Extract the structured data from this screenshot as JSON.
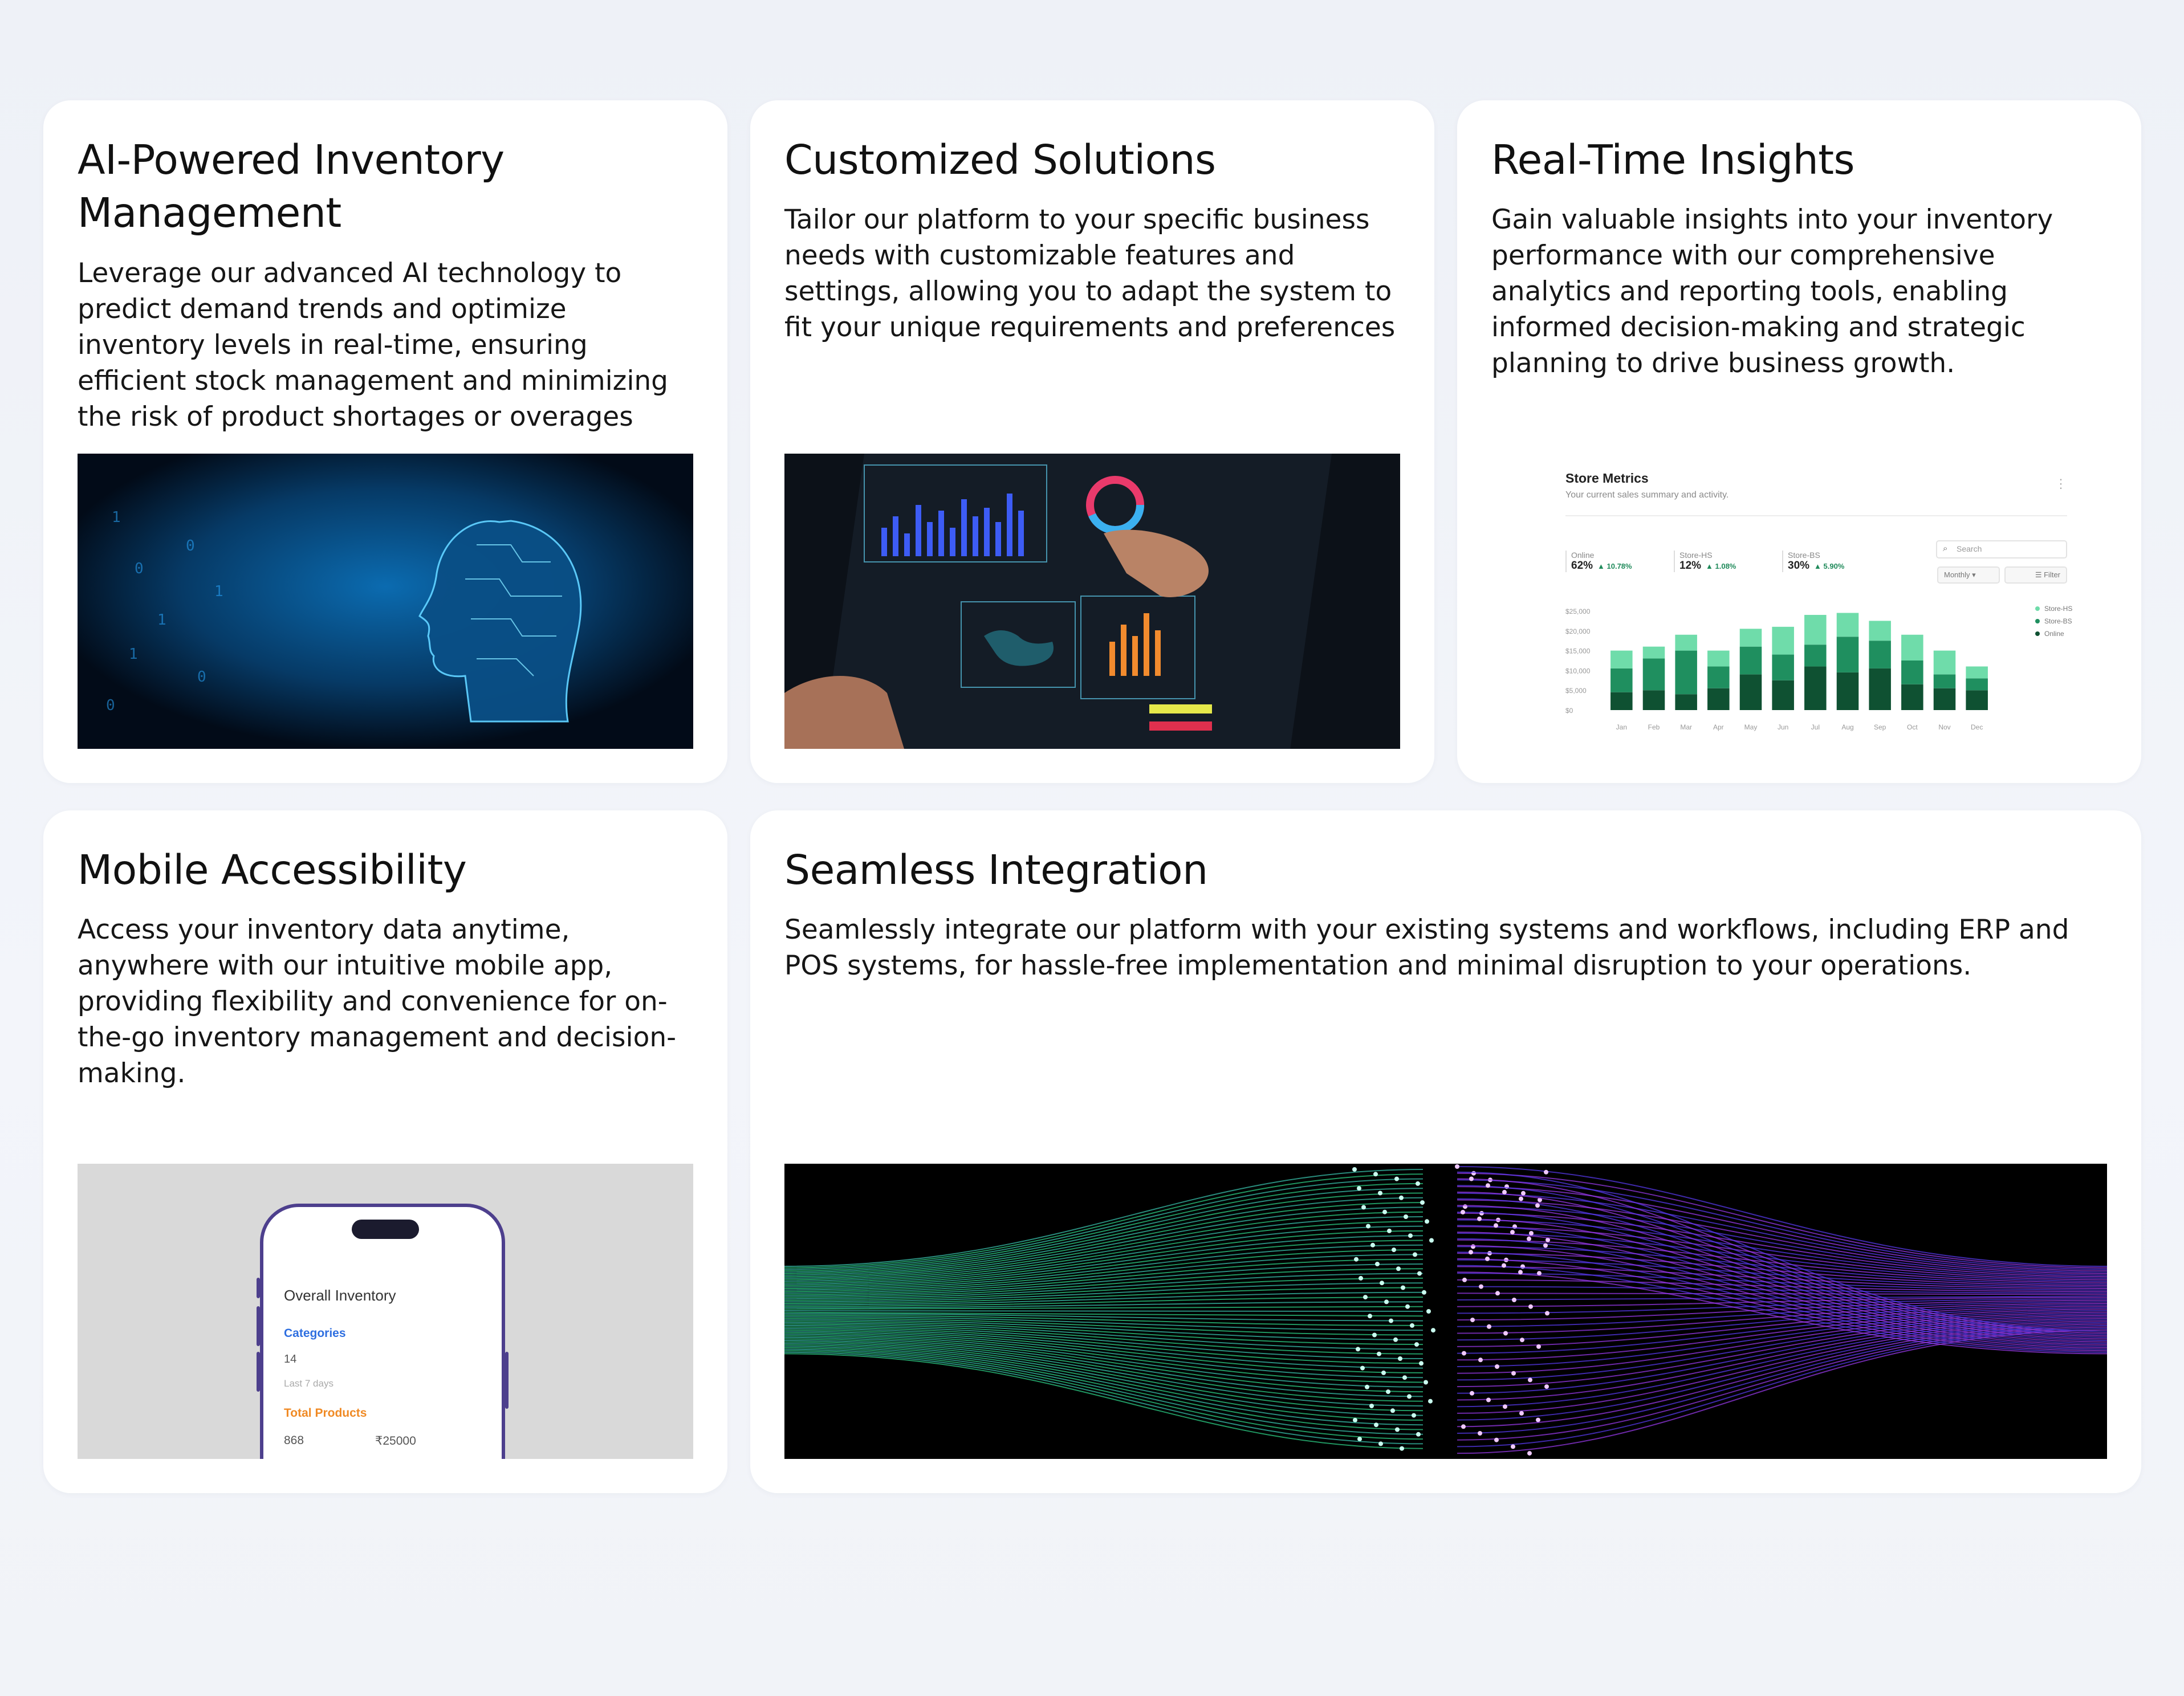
{
  "cards": [
    {
      "title": "AI-Powered Inventory Management",
      "title_line1": "AI-Powered Inventory",
      "title_line2": "Management",
      "description": "Leverage our advanced AI technology to predict demand trends and optimize inventory levels in real-time, ensuring efficient stock management and minimizing the risk of product shortages or overages"
    },
    {
      "title": "Customized Solutions",
      "description": "Tailor our platform to your specific business needs with customizable features and settings, allowing you to adapt the system to fit your unique requirements and preferences"
    },
    {
      "title": "Real-Time Insights",
      "description": "Gain valuable insights into your inventory performance with our comprehensive analytics and reporting tools, enabling informed decision-making and strategic planning to drive business growth."
    },
    {
      "title": "Mobile Accessibility",
      "description": "Access your inventory data anytime, anywhere with our intuitive mobile app, providing flexibility and convenience for on-the-go inventory management and decision-making."
    },
    {
      "title": "Seamless Integration",
      "description": "Seamlessly integrate our platform with your existing systems and workflows, including ERP and POS systems, for hassle-free implementation and minimal disruption to your operations."
    }
  ],
  "dashboard": {
    "title": "Store Metrics",
    "subtitle": "Your current sales summary and activity.",
    "search_placeholder": "Search",
    "monthly_label": "Monthly",
    "filter_label": "Filter",
    "metrics": [
      {
        "name": "Online",
        "value": "62%",
        "change": "▲ 10.78%"
      },
      {
        "name": "Store-HS",
        "value": "12%",
        "change": "▲ 1.08%"
      },
      {
        "name": "Store-BS",
        "value": "30%",
        "change": "▲ 5.90%"
      }
    ]
  },
  "chart_data": {
    "type": "bar",
    "stacked": true,
    "categories": [
      "Jan",
      "Feb",
      "Mar",
      "Apr",
      "May",
      "Jun",
      "Jul",
      "Aug",
      "Sep",
      "Oct",
      "Nov",
      "Dec"
    ],
    "y_ticks": [
      "$25,000",
      "$20,000",
      "$15,000",
      "$10,000",
      "$5,000",
      "$0"
    ],
    "ylim": [
      0,
      25000
    ],
    "series": [
      {
        "name": "Online",
        "color": "#0f5132",
        "values": [
          4500,
          5000,
          4000,
          5500,
          9000,
          7500,
          11000,
          9500,
          10500,
          6500,
          5500,
          5000
        ]
      },
      {
        "name": "Store-BS",
        "color": "#1f8f5f",
        "values": [
          6000,
          8000,
          11000,
          5500,
          7000,
          6500,
          5500,
          9000,
          7000,
          6000,
          3500,
          3000
        ]
      },
      {
        "name": "Store-HS",
        "color": "#6fdcaa",
        "values": [
          4500,
          3000,
          4000,
          4000,
          4500,
          7000,
          7500,
          6000,
          5000,
          6500,
          6000,
          3000
        ]
      }
    ],
    "legend": [
      "Store-HS",
      "Store-BS",
      "Online"
    ],
    "legend_position": "right"
  },
  "phone": {
    "title": "Overall Inventory",
    "categories_label": "Categories",
    "categories_value": "14",
    "period": "Last 7 days",
    "total_label": "Total Products",
    "total_value": "868",
    "total_amount": "₹25000"
  }
}
